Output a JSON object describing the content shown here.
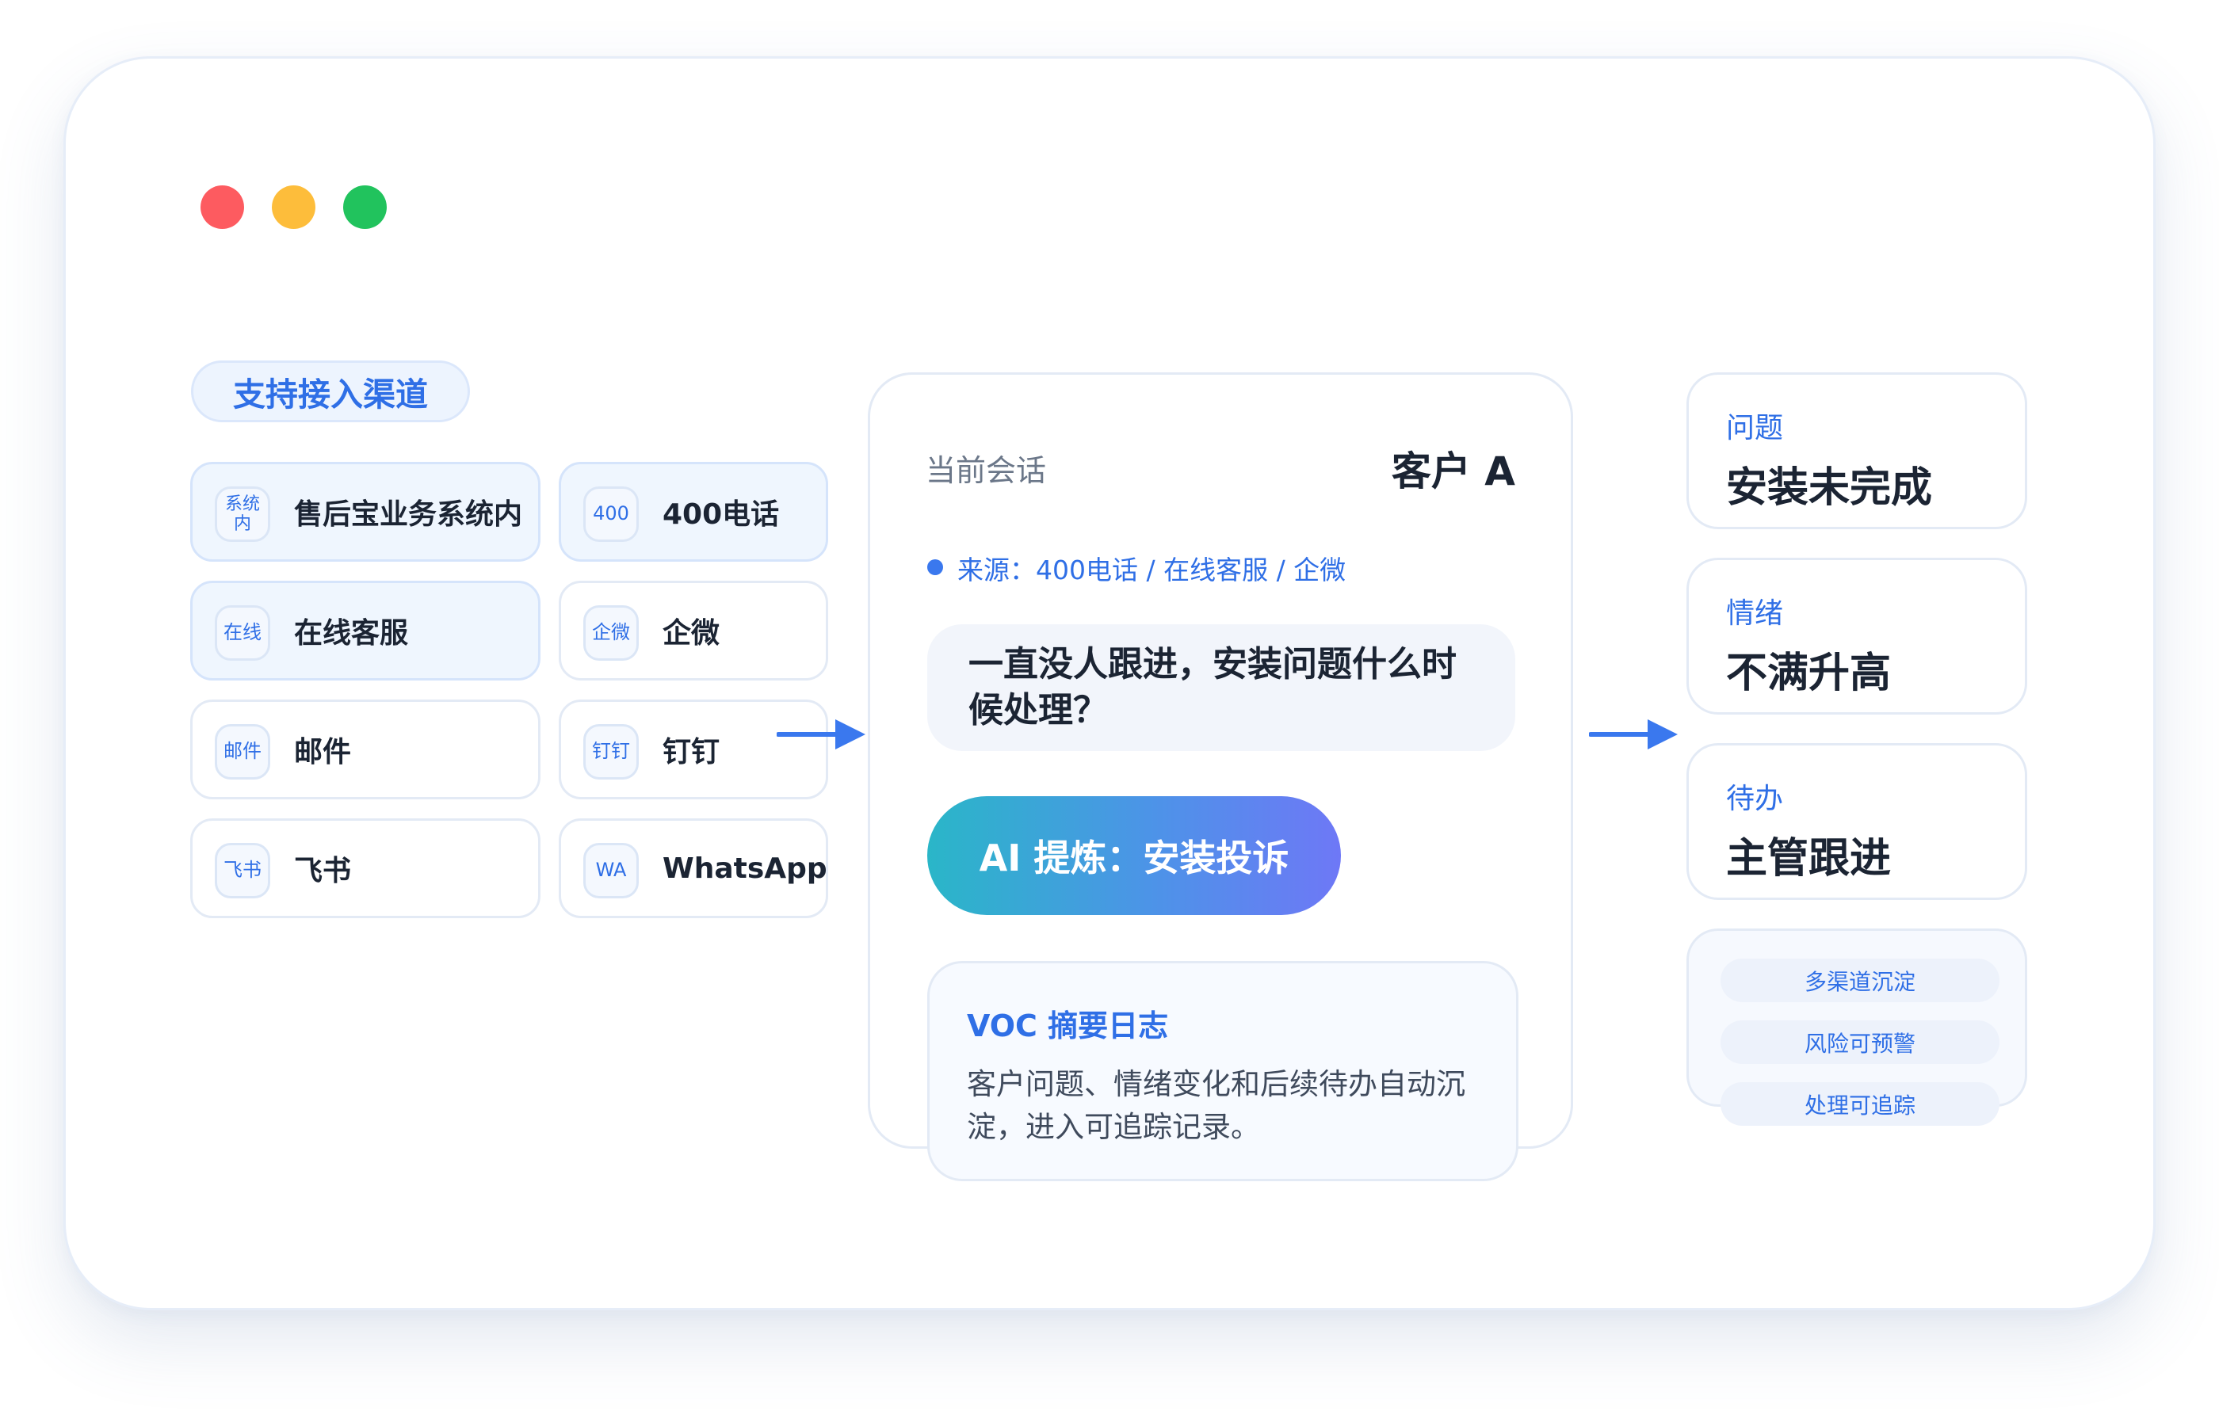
{
  "window": {
    "controls": [
      "close",
      "minimize",
      "maximize"
    ],
    "colors": {
      "close": "#fd5b60",
      "minimize": "#fdbd3b",
      "maximize": "#21c35d"
    }
  },
  "channels": {
    "title": "支持接入渠道",
    "items": [
      {
        "tag": "系统内",
        "label": "售后宝业务系统内",
        "highlighted": true
      },
      {
        "tag": "400",
        "label": "400电话",
        "highlighted": true
      },
      {
        "tag": "在线",
        "label": "在线客服",
        "highlighted": true
      },
      {
        "tag": "企微",
        "label": "企微",
        "highlighted": false
      },
      {
        "tag": "邮件",
        "label": "邮件",
        "highlighted": false
      },
      {
        "tag": "钉钉",
        "label": "钉钉",
        "highlighted": false
      },
      {
        "tag": "飞书",
        "label": "飞书",
        "highlighted": false
      },
      {
        "tag": "WA",
        "label": "WhatsApp",
        "highlighted": false
      }
    ]
  },
  "session": {
    "label": "当前会话",
    "customer": "客户 A",
    "source": "来源：400电话 / 在线客服 / 企微",
    "message": "一直没人跟进，安装问题什么时候处理？",
    "ai_summary": "AI 提炼：安装投诉",
    "voc": {
      "title": "VOC 摘要日志",
      "text": "客户问题、情绪变化和后续待办自动沉淀，进入可追踪记录。"
    }
  },
  "results": [
    {
      "label": "问题",
      "value": "安装未完成"
    },
    {
      "label": "情绪",
      "value": "不满升高"
    },
    {
      "label": "待办",
      "value": "主管跟进"
    }
  ],
  "features": [
    "多渠道沉淀",
    "风险可预警",
    "处理可追踪"
  ],
  "theme": {
    "accent": "#2f6fe6",
    "gradient_start": "#2ab6c8",
    "gradient_end": "#6e78f6"
  }
}
